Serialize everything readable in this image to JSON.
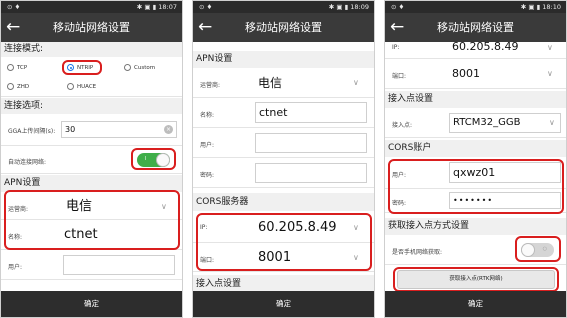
{
  "colors": {
    "titlebar": "#3a3a3a",
    "highlight": "#d91e1e",
    "toggle_on": "#3fae49",
    "radio_selected": "#1a73e8",
    "ok_bar": "#2d2d2d"
  },
  "screens": [
    {
      "status": {
        "left": "⊙ ♦",
        "right": "✱ ▣ ▮ 18:07"
      },
      "back_icon": "←",
      "title": "移动站网络设置",
      "conn_mode_header": "连接模式:",
      "radios": [
        "TCP",
        "NTRIP",
        "Custom",
        "ZHD",
        "HUACE"
      ],
      "selected_radio": "NTRIP",
      "conn_options_header": "连接选项:",
      "gga_label": "GGA上传间隔(s):",
      "gga_value": "30",
      "auto_connect_label": "自动连接网络:",
      "auto_connect_state": "on",
      "apn_header": "APN设置",
      "operator_label": "运营商:",
      "operator_value": "电信",
      "name_label": "名称:",
      "name_value": "ctnet",
      "user_label": "用户:",
      "ok": "确定"
    },
    {
      "status": {
        "left": "⊙ ♦",
        "right": "✱ ▣ ▮ 18:09"
      },
      "back_icon": "←",
      "title": "移动站网络设置",
      "apn_header": "APN设置",
      "operator_label": "运营商:",
      "operator_value": "电信",
      "name_label": "名称:",
      "name_value": "ctnet",
      "user_label": "用户:",
      "password_label": "密码:",
      "cors_header": "CORS服务器",
      "ip_label": "IP:",
      "ip_value": "60.205.8.49",
      "port_label": "端口:",
      "port_value": "8001",
      "mount_header": "接入点设置",
      "ok": "确定"
    },
    {
      "status": {
        "left": "⊙ ♦",
        "right": "✱ ▣ ▮ 18:10"
      },
      "back_icon": "←",
      "title": "移动站网络设置",
      "ip_label": "IP:",
      "ip_value": "60.205.8.49",
      "port_label": "端口:",
      "port_value": "8001",
      "mount_header": "接入点设置",
      "mount_label": "接入点:",
      "mount_value": "RTCM32_GGB",
      "cors_account_header": "CORS账户",
      "user_label": "用户:",
      "user_value": "qxwz01",
      "password_label": "密码:",
      "password_value": "•••••••",
      "get_mount_header": "获取接入点方式设置",
      "phone_net_label": "是否手机网络获取:",
      "phone_net_state": "off",
      "get_mount_button": "获取接入点(RTK网络)",
      "ok": "确定"
    }
  ]
}
